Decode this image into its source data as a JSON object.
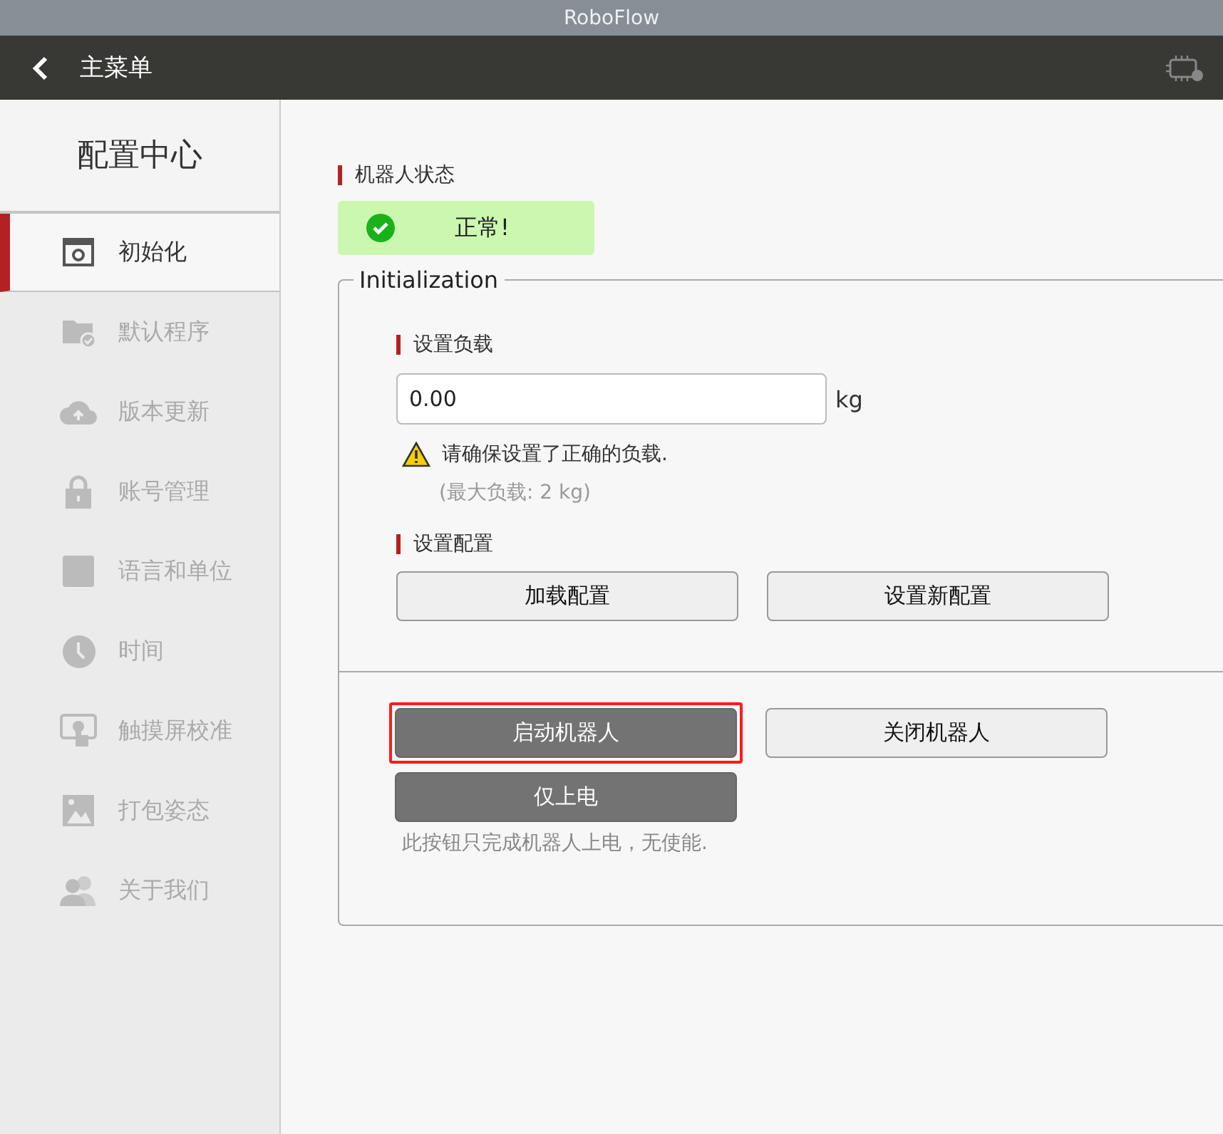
{
  "window": {
    "title": "RoboFlow"
  },
  "header": {
    "title": "主菜单"
  },
  "sidebar": {
    "title": "配置中心",
    "items": [
      {
        "label": "初始化",
        "selected": true
      },
      {
        "label": "默认程序",
        "selected": false
      },
      {
        "label": "版本更新",
        "selected": false
      },
      {
        "label": "账号管理",
        "selected": false
      },
      {
        "label": "语言和单位",
        "selected": false
      },
      {
        "label": "时间",
        "selected": false
      },
      {
        "label": "触摸屏校准",
        "selected": false
      },
      {
        "label": "打包姿态",
        "selected": false
      },
      {
        "label": "关于我们",
        "selected": false
      }
    ]
  },
  "status": {
    "label": "机器人状态",
    "text": "正常!"
  },
  "initialization": {
    "legend": "Initialization",
    "payload": {
      "label": "设置负载",
      "value": "0.00",
      "unit": "kg",
      "warning": "请确保设置了正确的负载.",
      "hint": "(最大负载: 2 kg)"
    },
    "config": {
      "label": "设置配置",
      "buttons": [
        {
          "label": "加载配置",
          "kind": "light"
        },
        {
          "label": "设置新配置",
          "kind": "light"
        }
      ]
    },
    "power": {
      "buttons": [
        {
          "label": "启动机器人",
          "kind": "dark",
          "highlighted": true
        },
        {
          "label": "关闭机器人",
          "kind": "light",
          "highlighted": false
        },
        {
          "label": "仅上电",
          "kind": "dark",
          "highlighted": false
        }
      ],
      "note": "此按钮只完成机器人上电，无使能."
    }
  }
}
